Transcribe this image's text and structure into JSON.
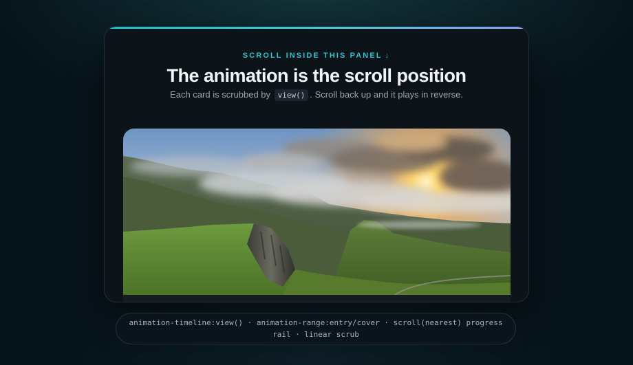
{
  "panel": {
    "eyebrow": "SCROLL INSIDE THIS PANEL",
    "eyebrow_icon": "arrow-down-icon",
    "title": "The animation is the scroll position",
    "subtitle_before": "Each card is scrubbed by",
    "subtitle_code": "view()",
    "subtitle_after": ". Scroll back up and it plays in reverse.",
    "card": {
      "image_subject": "landscape-photo",
      "image_alt": "Misty green highlands with a cliff and sunrise sky"
    }
  },
  "footer": {
    "status_text": "animation-timeline:view() · animation-range:entry/cover · scroll(nearest) progress rail · linear scrub"
  },
  "colors": {
    "background": "#07131a",
    "panel": "#0c1319",
    "accent": "#2fc2cf",
    "accent_gradient_end": "#8a9df2",
    "title": "#f4f6f8",
    "muted": "#9aa4ae"
  }
}
